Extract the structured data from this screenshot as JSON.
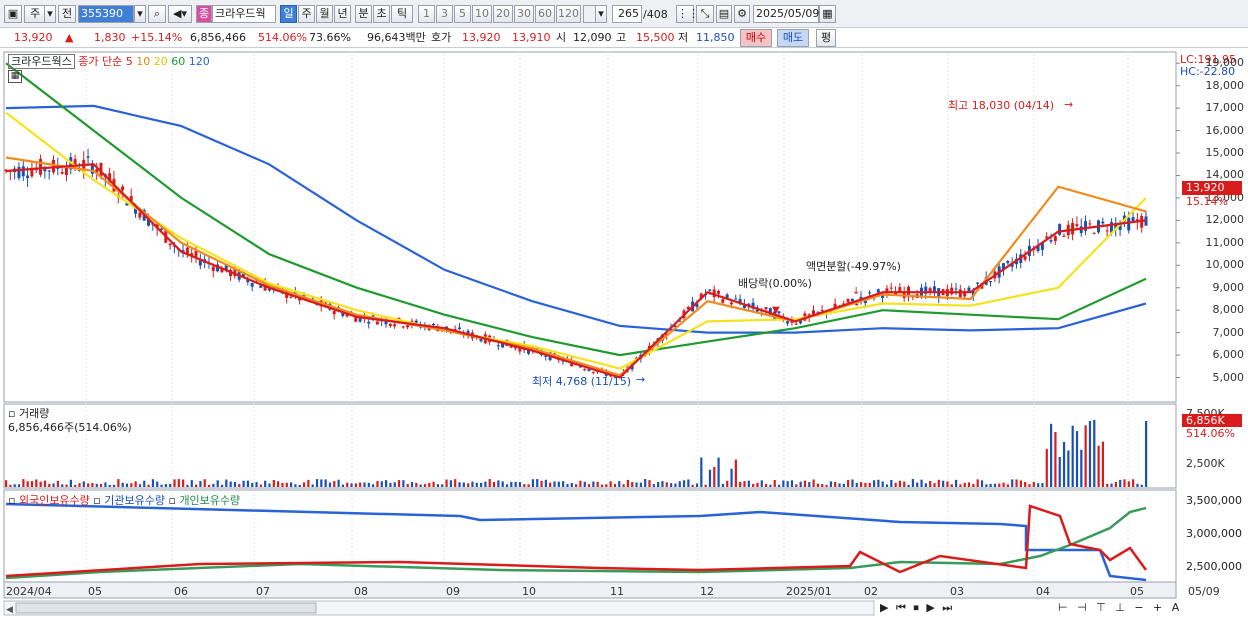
{
  "toolbar": {
    "mode1": "주",
    "mode2": "전",
    "code": "355390",
    "tag": "종",
    "name": "크라우드웍",
    "periods": [
      "일",
      "주",
      "월",
      "년",
      "분",
      "초",
      "틱"
    ],
    "nums": [
      "1",
      "3",
      "5",
      "10",
      "20",
      "30",
      "60",
      "120"
    ],
    "count": "265",
    "count_total": "/408",
    "date": "2025/05/09"
  },
  "quote": {
    "price": "13,920",
    "arrow": "▲",
    "change": "1,830",
    "pct": "+15.14%",
    "volume": "6,856,466",
    "vol_ratio": "514.06%",
    "rate": "73.66%",
    "amount": "96,643백만",
    "hoga_label": "호가",
    "ask": "13,920",
    "bid": "13,910",
    "open_label": "시",
    "open": "12,090",
    "high_label": "고",
    "high": "15,500",
    "low_label": "저",
    "low": "11,850",
    "buy": "매수",
    "sell": "매도",
    "eval": "평"
  },
  "legend": {
    "name": "크라우드웍스",
    "type": "종가 단순",
    "ma": [
      "5",
      "10",
      "20",
      "60",
      "120"
    ]
  },
  "axis_right": {
    "lc": "LC:191.95",
    "hc": "HC:-22.80",
    "price_ticks": [
      "19,000",
      "18,000",
      "17,000",
      "16,000",
      "15,000",
      "14,000",
      "13,000",
      "12,000",
      "11,000",
      "10,000",
      "9,000",
      "8,000",
      "7,000",
      "6,000",
      "5,000"
    ],
    "cur_price": "13,920",
    "cur_pct": "15.14%",
    "vol_ticks": [
      "7,500K",
      "2,500K"
    ],
    "cur_vol": "6,856K",
    "cur_vol_pct": "514.06%",
    "hold_ticks": [
      "3,500,000",
      "3,000,000",
      "2,500,000"
    ]
  },
  "annotations": {
    "high": "최고 18,030 (04/14)",
    "low": "최저 4,768 (11/15)",
    "div": "배당락(0.00%)",
    "split": "액면분할(-49.97%)"
  },
  "volume_panel": {
    "title": "거래량",
    "value": "6,856,466주(514.06%)"
  },
  "holdings_panel": {
    "series": [
      "외국인보유수량",
      "기관보유수량",
      "개인보유수량"
    ]
  },
  "x_axis": [
    "2024/04",
    "05",
    "06",
    "07",
    "08",
    "09",
    "10",
    "11",
    "12",
    "2025/01",
    "02",
    "03",
    "04",
    "05",
    "05/09"
  ],
  "colors": {
    "ma5": "#d81c1c",
    "ma10": "#f08a1c",
    "ma20": "#f5e31c",
    "ma60": "#1f9a2e",
    "ma120": "#2a62d8",
    "up": "#d81c1c",
    "down": "#1a4fb8"
  },
  "chart_data": {
    "type": "line",
    "title": "",
    "x": [
      "2024/04",
      "05",
      "06",
      "07",
      "08",
      "09",
      "10",
      "11",
      "12",
      "2025/01",
      "02",
      "03",
      "04",
      "05"
    ],
    "series": [
      {
        "name": "5",
        "values": [
          14200,
          14500,
          10600,
          9000,
          7700,
          7200,
          6200,
          5000,
          8800,
          7500,
          8800,
          8800,
          11500,
          12000
        ]
      },
      {
        "name": "10",
        "values": [
          14800,
          14200,
          11000,
          9100,
          7800,
          7100,
          6300,
          5100,
          8400,
          7500,
          8700,
          8500,
          13500,
          12400
        ]
      },
      {
        "name": "20",
        "values": [
          16800,
          13800,
          11200,
          9200,
          8000,
          7100,
          6400,
          5400,
          7500,
          7600,
          8300,
          8200,
          9000,
          13000
        ]
      },
      {
        "name": "60",
        "values": [
          19000,
          16000,
          13000,
          10500,
          9000,
          7800,
          6800,
          6000,
          6600,
          7200,
          8000,
          7800,
          7600,
          9400
        ]
      },
      {
        "name": "120",
        "values": [
          17000,
          17100,
          16200,
          14500,
          12000,
          9800,
          8400,
          7300,
          7000,
          7000,
          7200,
          7100,
          7200,
          8300
        ]
      }
    ],
    "ylim": [
      4000,
      19500
    ]
  }
}
